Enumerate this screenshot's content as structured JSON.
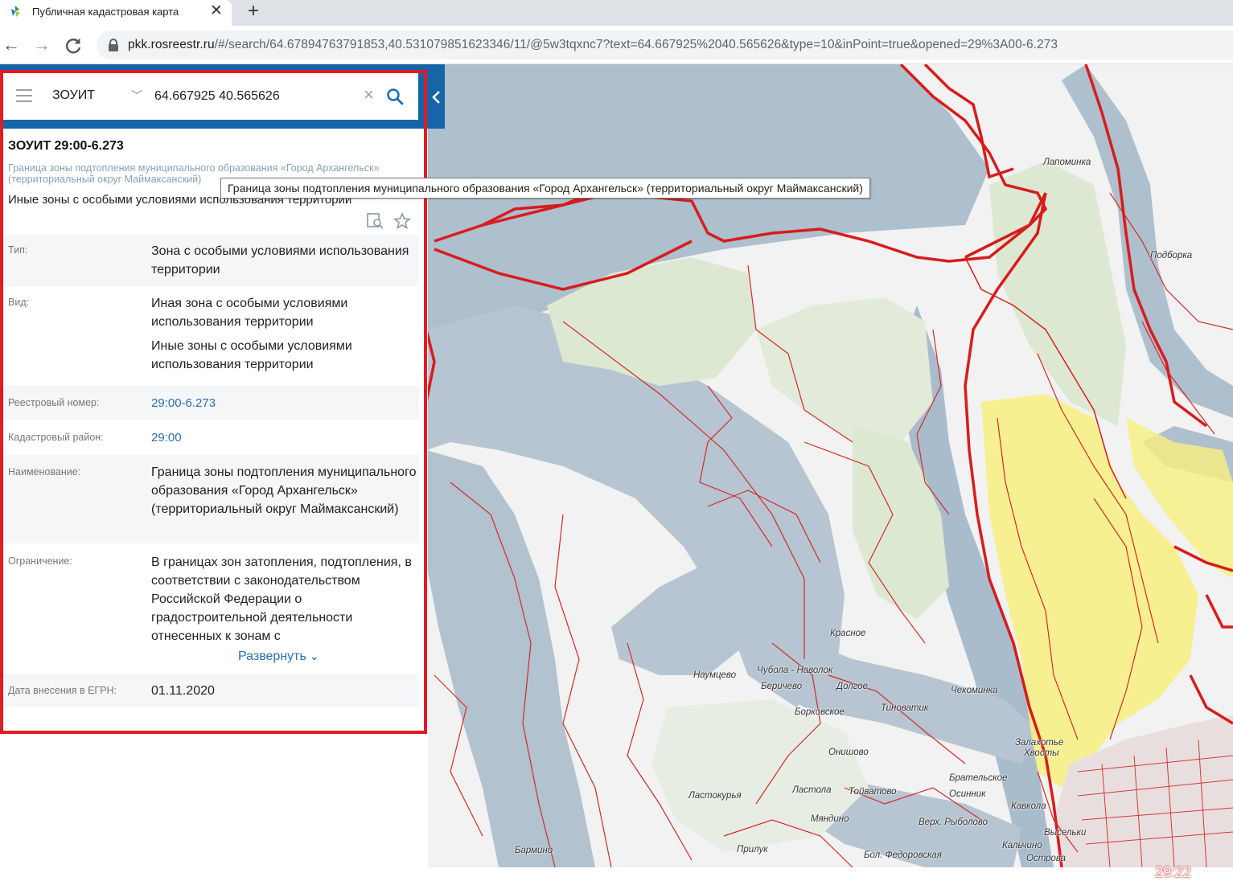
{
  "browser": {
    "tab_title": "Публичная кадастровая карта",
    "url_host": "pkk.rosreestr.ru",
    "url_rest": "/#/search/64.67894763791853,40.531079851623346/11/@5w3tqxnc7?text=64.667925%2040.565626&type=10&inPoint=true&opened=29%3A00-6.273"
  },
  "search": {
    "layer": "ЗОУИТ",
    "query": "64.667925 40.565626"
  },
  "info": {
    "title": "ЗОУИТ 29:00-6.273",
    "subtitle": "Граница зоны подтопления муниципального образования «Город Архангельск» (территориальный округ Маймаксанский)",
    "category": "Иные зоны с особыми условиями использования территории",
    "rows": [
      {
        "label": "Тип:",
        "value": "Зона с особыми условиями использования территории"
      },
      {
        "label": "Вид:",
        "value": "Иная зона с особыми условиями использования территории",
        "value2": "Иные зоны с особыми условиями использования территории"
      },
      {
        "label": "Реестровый номер:",
        "value": "29:00-6.273"
      },
      {
        "label": "Кадастровый район:",
        "value": "29:00"
      },
      {
        "label": "Наименование:",
        "value": "Граница зоны подтопления муниципального образования «Город Архангельск» (территориальный округ Маймаксанский)"
      },
      {
        "label": "Ограничение:",
        "value": "В границах зон затопления, подтопления, в соответствии с законодательством Российской Федерации о градостроительной деятельности отнесенных к зонам с"
      },
      {
        "label": "Дата внесения в ЕГРН:",
        "value": "01.11.2020"
      }
    ],
    "expand_label": "Развернуть"
  },
  "tooltip": "Граница зоны подтопления муниципального образования «Город Архангельск» (территориальный округ Маймаксанский)",
  "map": {
    "places": [
      "Лапоминка",
      "Подборка",
      "Красное",
      "Наумцево",
      "Чубола - Наволок",
      "Беричево",
      "Долгое",
      "Чекоминка",
      "Борковское",
      "Тиноватик",
      "Залахотье",
      "Хвосты",
      "Онишово",
      "Брательское",
      "Осинник",
      "Ластола",
      "Тойватово",
      "Ластокурья",
      "Кавкола",
      "Мяндино",
      "Верх. Рыболово",
      "Высельки",
      "Кальчино",
      "Прилук",
      "Бармино",
      "Бол. Федоровская",
      "Острова"
    ],
    "sheet_number": "29:22"
  },
  "colors": {
    "panel_blue": "#1565a8",
    "frame_red": "#e31b23",
    "link_blue": "#2a6fb0",
    "water": "#aebfcd",
    "forest": "#dde8d2",
    "flood_zone": "#f8f080"
  }
}
